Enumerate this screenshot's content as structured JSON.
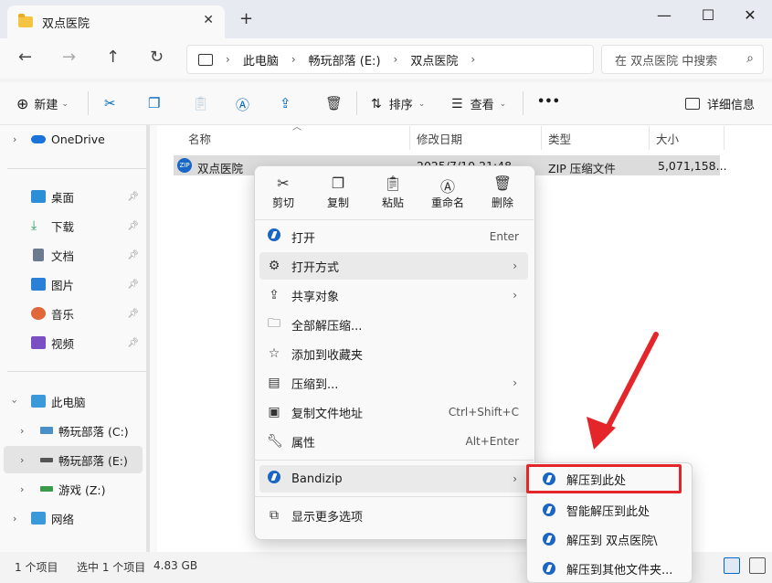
{
  "window": {
    "tab_title": "双点医院",
    "close_tab": "✕",
    "new_tab": "+",
    "minimize": "—",
    "maximize": "☐",
    "close": "✕"
  },
  "nav": {
    "back": "←",
    "forward": "→",
    "up": "↑",
    "refresh": "↻",
    "breadcrumbs": [
      "此电脑",
      "畅玩部落 (E:)",
      "双点医院"
    ],
    "search_placeholder": "在 双点医院 中搜索"
  },
  "toolbar": {
    "new_label": "新建",
    "sort_label": "排序",
    "view_label": "查看",
    "more": "•••",
    "details_label": "详细信息"
  },
  "sidebar": {
    "onedrive": "OneDrive",
    "quick": [
      {
        "label": "桌面",
        "icon": "desktop-icon",
        "color": "#2d8ed8"
      },
      {
        "label": "下载",
        "icon": "download-icon",
        "color": "#1f9e5a"
      },
      {
        "label": "文档",
        "icon": "document-icon",
        "color": "#6b7a8f"
      },
      {
        "label": "图片",
        "icon": "pictures-icon",
        "color": "#2a80d6"
      },
      {
        "label": "音乐",
        "icon": "music-icon",
        "color": "#e0673a"
      },
      {
        "label": "视频",
        "icon": "video-icon",
        "color": "#7b4fc4"
      }
    ],
    "this_pc": "此电脑",
    "drives": [
      {
        "label": "畅玩部落 (C:)"
      },
      {
        "label": "畅玩部落 (E:)"
      },
      {
        "label": "游戏 (Z:)"
      }
    ],
    "network": "网络"
  },
  "columns": {
    "name": "名称",
    "date": "修改日期",
    "type": "类型",
    "size": "大小"
  },
  "file": {
    "name": "双点医院",
    "date": "2025/7/10 21:48",
    "type": "ZIP 压缩文件",
    "size": "5,071,158..."
  },
  "status": {
    "count": "1 个项目",
    "selected": "选中 1 个项目",
    "size": "4.83 GB"
  },
  "context_menu": {
    "quick_actions": [
      "剪切",
      "复制",
      "粘贴",
      "重命名",
      "删除"
    ],
    "items": [
      {
        "label": "打开",
        "shortcut": "Enter"
      },
      {
        "label": "打开方式",
        "shortcut": ""
      },
      {
        "label": "共享对象",
        "shortcut": ""
      },
      {
        "label": "全部解压缩...",
        "shortcut": ""
      },
      {
        "label": "添加到收藏夹",
        "shortcut": ""
      },
      {
        "label": "压缩到...",
        "shortcut": ""
      },
      {
        "label": "复制文件地址",
        "shortcut": "Ctrl+Shift+C"
      },
      {
        "label": "属性",
        "shortcut": "Alt+Enter"
      },
      {
        "label": "Bandizip",
        "shortcut": ""
      },
      {
        "label": "显示更多选项",
        "shortcut": ""
      }
    ]
  },
  "submenu": {
    "items": [
      "解压到此处",
      "智能解压到此处",
      "解压到 双点医院\\",
      "解压到其他文件夹..."
    ]
  },
  "colors": {
    "accent": "#0067c0",
    "highlight_red": "#e4262b",
    "selection_gray": "#dcdcdc"
  }
}
